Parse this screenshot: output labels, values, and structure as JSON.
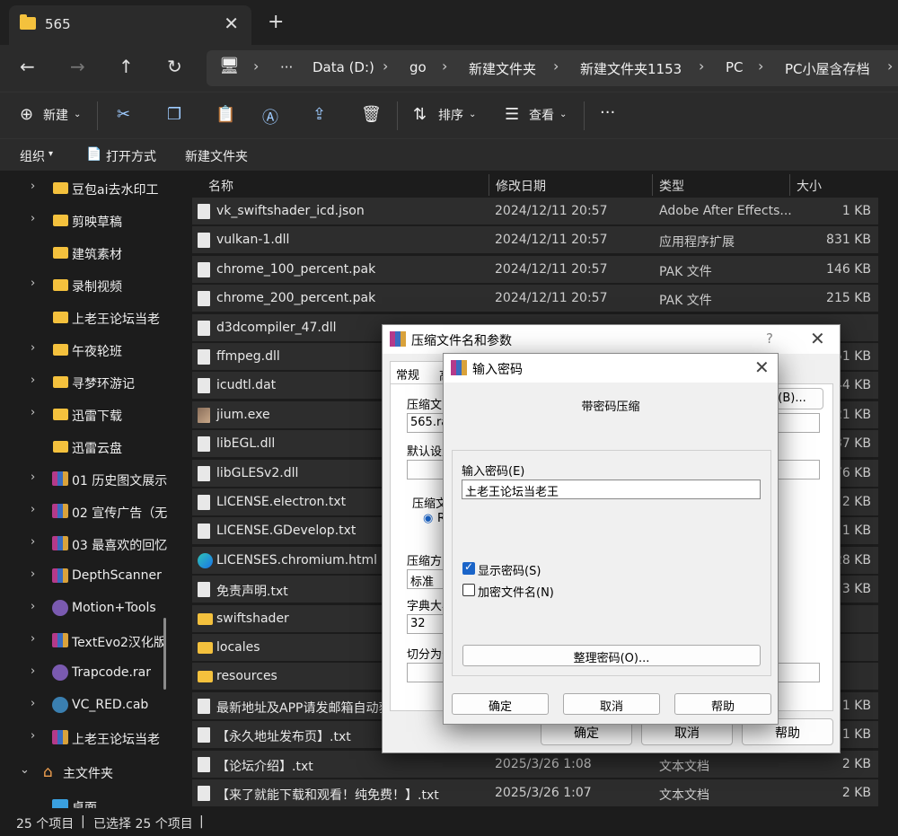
{
  "window": {
    "tab_title": "565",
    "new_tab": "+",
    "close": "✕"
  },
  "nav": {
    "back": "←",
    "forward": "→",
    "up": "↑",
    "refresh": "↻"
  },
  "breadcrumb": [
    "Data (D:)",
    "go",
    "新建文件夹",
    "新建文件夹1153",
    "PC",
    "PC小屋含存档"
  ],
  "breadcrumb_more": "···",
  "toolbar": {
    "new_label": "新建",
    "sort_label": "排序",
    "view_label": "查看",
    "more": "···"
  },
  "toolbar2": {
    "organize": "组织",
    "open_with": "打开方式",
    "new_folder": "新建文件夹"
  },
  "sidebar": {
    "items": [
      {
        "label": "豆包ai去水印工",
        "icon": "folder",
        "chev": true
      },
      {
        "label": "剪映草稿",
        "icon": "folder",
        "chev": true
      },
      {
        "label": "建筑素材",
        "icon": "folder",
        "chev": false
      },
      {
        "label": "录制视频",
        "icon": "folder",
        "chev": true
      },
      {
        "label": "上老王论坛当老",
        "icon": "folder",
        "chev": false
      },
      {
        "label": "午夜轮班",
        "icon": "folder",
        "chev": true
      },
      {
        "label": "寻梦环游记",
        "icon": "folder",
        "chev": true
      },
      {
        "label": "迅雷下载",
        "icon": "folder",
        "chev": true
      },
      {
        "label": "迅雷云盘",
        "icon": "folder",
        "chev": false
      },
      {
        "label": "01 历史图文展示",
        "icon": "rar",
        "chev": true
      },
      {
        "label": "02 宣传广告（无",
        "icon": "rar",
        "chev": true
      },
      {
        "label": "03 最喜欢的回忆",
        "icon": "rar",
        "chev": true
      },
      {
        "label": "DepthScanner",
        "icon": "rar",
        "chev": true
      },
      {
        "label": "Motion+Tools",
        "icon": "purple",
        "chev": true
      },
      {
        "label": "TextEvo2汉化版",
        "icon": "rar",
        "chev": true
      },
      {
        "label": "Trapcode.rar",
        "icon": "purple",
        "chev": true
      },
      {
        "label": "VC_RED.cab",
        "icon": "cab",
        "chev": true
      },
      {
        "label": "上老王论坛当老",
        "icon": "rar",
        "chev": true
      },
      {
        "label": "主文件夹",
        "icon": "home",
        "chev": "down"
      },
      {
        "label": "桌面",
        "icon": "desktop",
        "chev": false
      }
    ]
  },
  "columns": {
    "name": "名称",
    "date": "修改日期",
    "type": "类型",
    "size": "大小"
  },
  "files": [
    {
      "name": "vk_swiftshader_icd.json",
      "date": "2024/12/11 20:57",
      "type": "Adobe After Effects...",
      "size": "1 KB",
      "icon": "doc"
    },
    {
      "name": "vulkan-1.dll",
      "date": "2024/12/11 20:57",
      "type": "应用程序扩展",
      "size": "831 KB",
      "icon": "doc"
    },
    {
      "name": "chrome_100_percent.pak",
      "date": "2024/12/11 20:57",
      "type": "PAK 文件",
      "size": "146 KB",
      "icon": "doc"
    },
    {
      "name": "chrome_200_percent.pak",
      "date": "2024/12/11 20:57",
      "type": "PAK 文件",
      "size": "215 KB",
      "icon": "doc"
    },
    {
      "name": "d3dcompiler_47.dll",
      "date": "",
      "type": "",
      "size": "",
      "icon": "doc"
    },
    {
      "name": "ffmpeg.dll",
      "date": "",
      "type": "",
      "size": "51 KB",
      "icon": "doc"
    },
    {
      "name": "icudtl.dat",
      "date": "",
      "type": "",
      "size": "44 KB",
      "icon": "doc"
    },
    {
      "name": "jium.exe",
      "date": "",
      "type": "",
      "size": "21 KB",
      "icon": "exe"
    },
    {
      "name": "libEGL.dll",
      "date": "",
      "type": "",
      "size": "37 KB",
      "icon": "doc"
    },
    {
      "name": "libGLESv2.dll",
      "date": "",
      "type": "",
      "size": "76 KB",
      "icon": "doc"
    },
    {
      "name": "LICENSE.electron.txt",
      "date": "",
      "type": "",
      "size": "2 KB",
      "icon": "doc"
    },
    {
      "name": "LICENSE.GDevelop.txt",
      "date": "",
      "type": "",
      "size": "1 KB",
      "icon": "doc"
    },
    {
      "name": "LICENSES.chromium.html",
      "date": "",
      "type": "",
      "size": "28 KB",
      "icon": "edge"
    },
    {
      "name": "免责声明.txt",
      "date": "",
      "type": "",
      "size": "3 KB",
      "icon": "doc"
    },
    {
      "name": "swiftshader",
      "date": "",
      "type": "",
      "size": "",
      "icon": "folder"
    },
    {
      "name": "locales",
      "date": "",
      "type": "",
      "size": "",
      "icon": "folder"
    },
    {
      "name": "resources",
      "date": "",
      "type": "",
      "size": "",
      "icon": "folder"
    },
    {
      "name": "最新地址及APP请发邮箱自动获",
      "date": "",
      "type": "",
      "size": "1 KB",
      "icon": "doc"
    },
    {
      "name": "【永久地址发布页】.txt",
      "date": "",
      "type": "",
      "size": "1 KB",
      "icon": "doc"
    },
    {
      "name": "【论坛介绍】.txt",
      "date": "2025/3/26 1:08",
      "type": "文本文档",
      "size": "2 KB",
      "icon": "doc"
    },
    {
      "name": "【来了就能下载和观看！纯免费！】.txt",
      "date": "2025/3/26 1:07",
      "type": "文本文档",
      "size": "2 KB",
      "icon": "doc"
    }
  ],
  "status": {
    "count": "25 个项目",
    "selected": "已选择 25 个项目"
  },
  "archive_dialog": {
    "title": "压缩文件名和参数",
    "help_q": "?",
    "tab_general": "常规",
    "tab_second": "高",
    "archive_name_label": "压缩文",
    "archive_name_value": "565.ra",
    "browse_label": "(B)...",
    "default_settings_label": "默认设置",
    "format_label": "压缩文",
    "format_radio": "R",
    "method_label": "压缩方",
    "method_value": "标准",
    "dict_label": "字典大小",
    "dict_value": "32",
    "split_label": "切分为分",
    "ok": "确定",
    "cancel": "取消",
    "help": "帮助"
  },
  "password_dialog": {
    "title": "输入密码",
    "heading": "带密码压缩",
    "password_label": "输入密码(E)",
    "password_value": "上老王论坛当老王",
    "show_password": "显示密码(S)",
    "encrypt_names": "加密文件名(N)",
    "organize": "整理密码(O)...",
    "ok": "确定",
    "cancel": "取消",
    "help": "帮助"
  }
}
